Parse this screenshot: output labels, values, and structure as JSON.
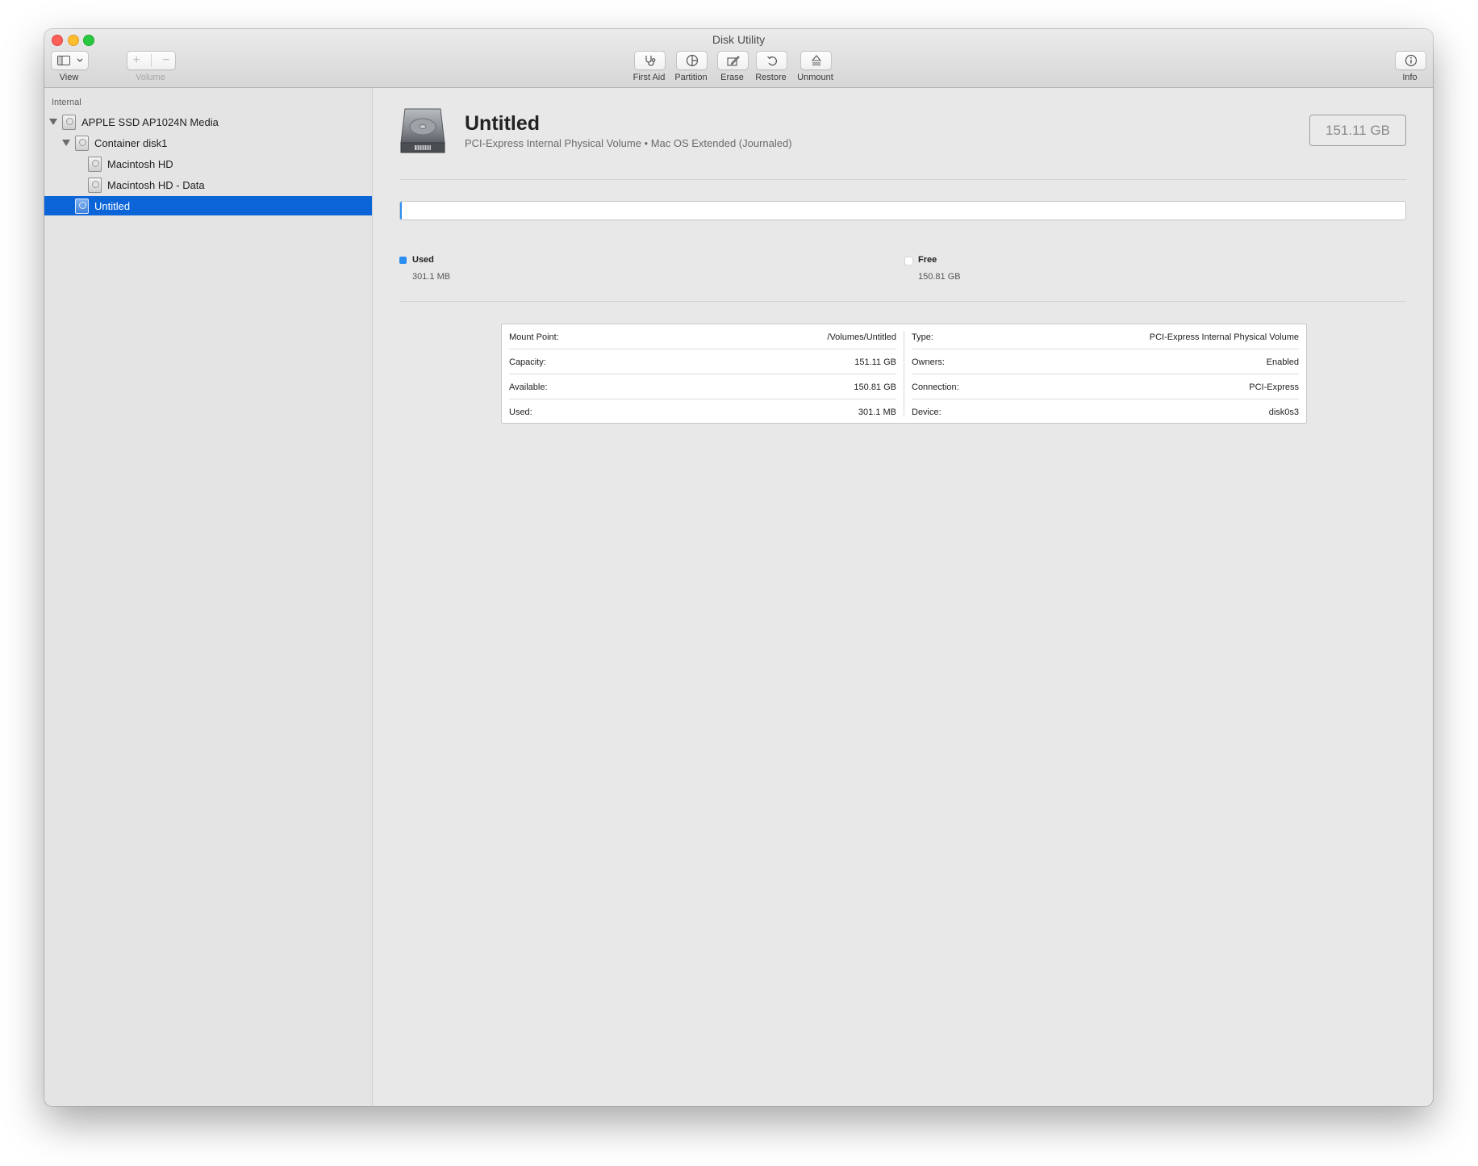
{
  "window": {
    "title": "Disk Utility"
  },
  "toolbar": {
    "view_label": "View",
    "volume_label": "Volume",
    "first_aid_label": "First Aid",
    "partition_label": "Partition",
    "erase_label": "Erase",
    "restore_label": "Restore",
    "unmount_label": "Unmount",
    "info_label": "Info"
  },
  "sidebar": {
    "section": "Internal",
    "items": [
      {
        "label": "APPLE SSD AP1024N Media"
      },
      {
        "label": "Container disk1"
      },
      {
        "label": "Macintosh HD"
      },
      {
        "label": "Macintosh HD - Data"
      },
      {
        "label": "Untitled",
        "selected": true
      }
    ]
  },
  "volume": {
    "name": "Untitled",
    "subtitle": "PCI-Express Internal Physical Volume • Mac OS Extended (Journaled)",
    "size": "151.11 GB",
    "used_fraction": 0.002
  },
  "usage": {
    "used_title": "Used",
    "used_value": "301.1 MB",
    "free_title": "Free",
    "free_value": "150.81 GB",
    "used_color": "#2c8ff0",
    "free_color": "#ffffff"
  },
  "info": {
    "left": [
      {
        "key": "Mount Point:",
        "value": "/Volumes/Untitled"
      },
      {
        "key": "Capacity:",
        "value": "151.11 GB"
      },
      {
        "key": "Available:",
        "value": "150.81 GB"
      },
      {
        "key": "Used:",
        "value": "301.1 MB"
      }
    ],
    "right": [
      {
        "key": "Type:",
        "value": "PCI-Express Internal Physical Volume"
      },
      {
        "key": "Owners:",
        "value": "Enabled"
      },
      {
        "key": "Connection:",
        "value": "PCI-Express"
      },
      {
        "key": "Device:",
        "value": "disk0s3"
      }
    ]
  },
  "icons": {
    "view": "sidebar-icon",
    "first_aid": "stethoscope-icon",
    "partition": "pie-icon",
    "erase": "pencil-icon",
    "restore": "undo-arrow-icon",
    "unmount": "eject-icon",
    "info": "info-circle-icon"
  }
}
